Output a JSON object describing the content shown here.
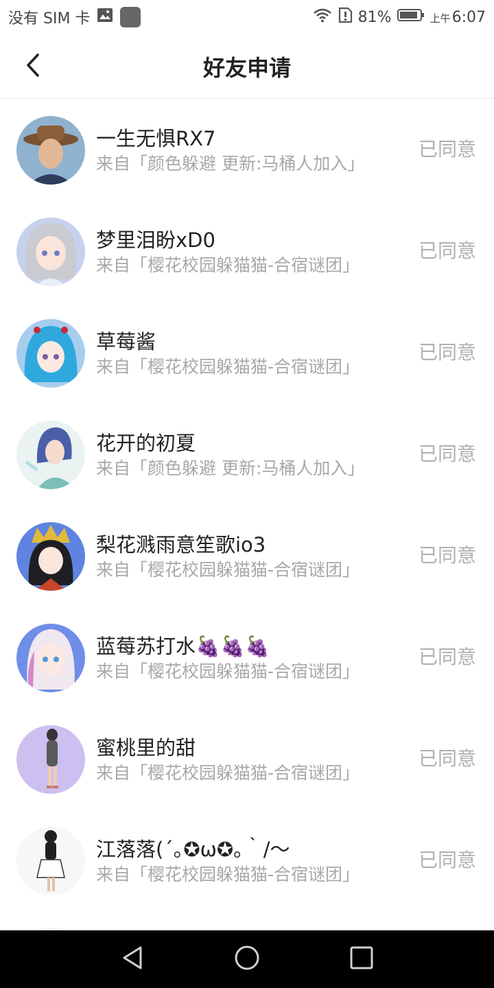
{
  "status_bar": {
    "carrier": "没有 SIM 卡",
    "battery": "81%",
    "ampm": "上午",
    "time": "6:07"
  },
  "header": {
    "title": "好友申请"
  },
  "requests": [
    {
      "name": "一生无惧RX7",
      "source": "来自「颜色躲避 更新:马桶人加入」",
      "status": "已同意"
    },
    {
      "name": "梦里泪盼xD0",
      "source": "来自「樱花校园躲猫猫-合宿谜团」",
      "status": "已同意"
    },
    {
      "name": "草莓酱",
      "source": "来自「樱花校园躲猫猫-合宿谜团」",
      "status": "已同意"
    },
    {
      "name": "花开的初夏",
      "source": "来自「颜色躲避 更新:马桶人加入」",
      "status": "已同意"
    },
    {
      "name": "梨花溅雨意笙歌io3",
      "source": "来自「樱花校园躲猫猫-合宿谜团」",
      "status": "已同意"
    },
    {
      "name": "蓝莓苏打水🍇🍇🍇",
      "source": "来自「樱花校园躲猫猫-合宿谜团」",
      "status": "已同意"
    },
    {
      "name": "蜜桃里的甜",
      "source": "来自「樱花校园躲猫猫-合宿谜团」",
      "status": "已同意"
    },
    {
      "name": "江落落(´｡✪ω✪｡｀/～",
      "source": "来自「樱花校园躲猫猫-合宿谜团」",
      "status": "已同意"
    }
  ],
  "colors": {
    "status_text": "#b0b0b0",
    "source_text": "#a8a8a8",
    "nav_bar": "#000000"
  },
  "icons": {
    "back": "chevron-left-icon",
    "nav_back": "triangle-back-icon",
    "nav_home": "circle-home-icon",
    "nav_recent": "square-recent-icon"
  }
}
